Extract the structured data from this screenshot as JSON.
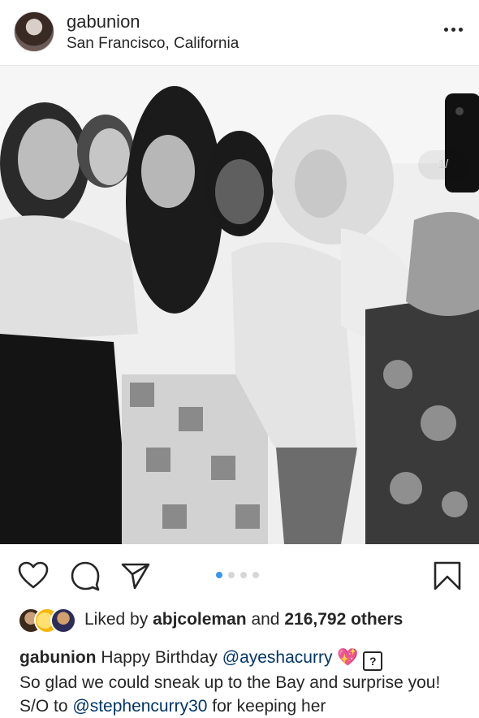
{
  "post": {
    "username": "gabunion",
    "location": "San Francisco, California",
    "carousel_counter": "1/",
    "carousel_total_dots": 4,
    "carousel_active_index": 1
  },
  "likes": {
    "prefix": "Liked by",
    "liker": "abjcoleman",
    "middle": "and",
    "count": "216,792 others"
  },
  "caption": {
    "username": "gabunion",
    "text1": "Happy Birthday",
    "mention1": "@ayeshacurry",
    "heart": "💖",
    "unknown": "?",
    "text2": "So glad we could sneak up to the Bay and surprise you! S/O to",
    "mention2": "@stephencurry30",
    "text3": "for keeping her"
  },
  "icons": {
    "more": "more-options-icon",
    "like": "heart-icon",
    "comment": "comment-icon",
    "share": "paper-plane-icon",
    "save": "bookmark-icon",
    "user_tag": "user-tag-icon"
  },
  "colors": {
    "accent_blue": "#3897f0",
    "mention": "#003569",
    "text": "#262626"
  }
}
